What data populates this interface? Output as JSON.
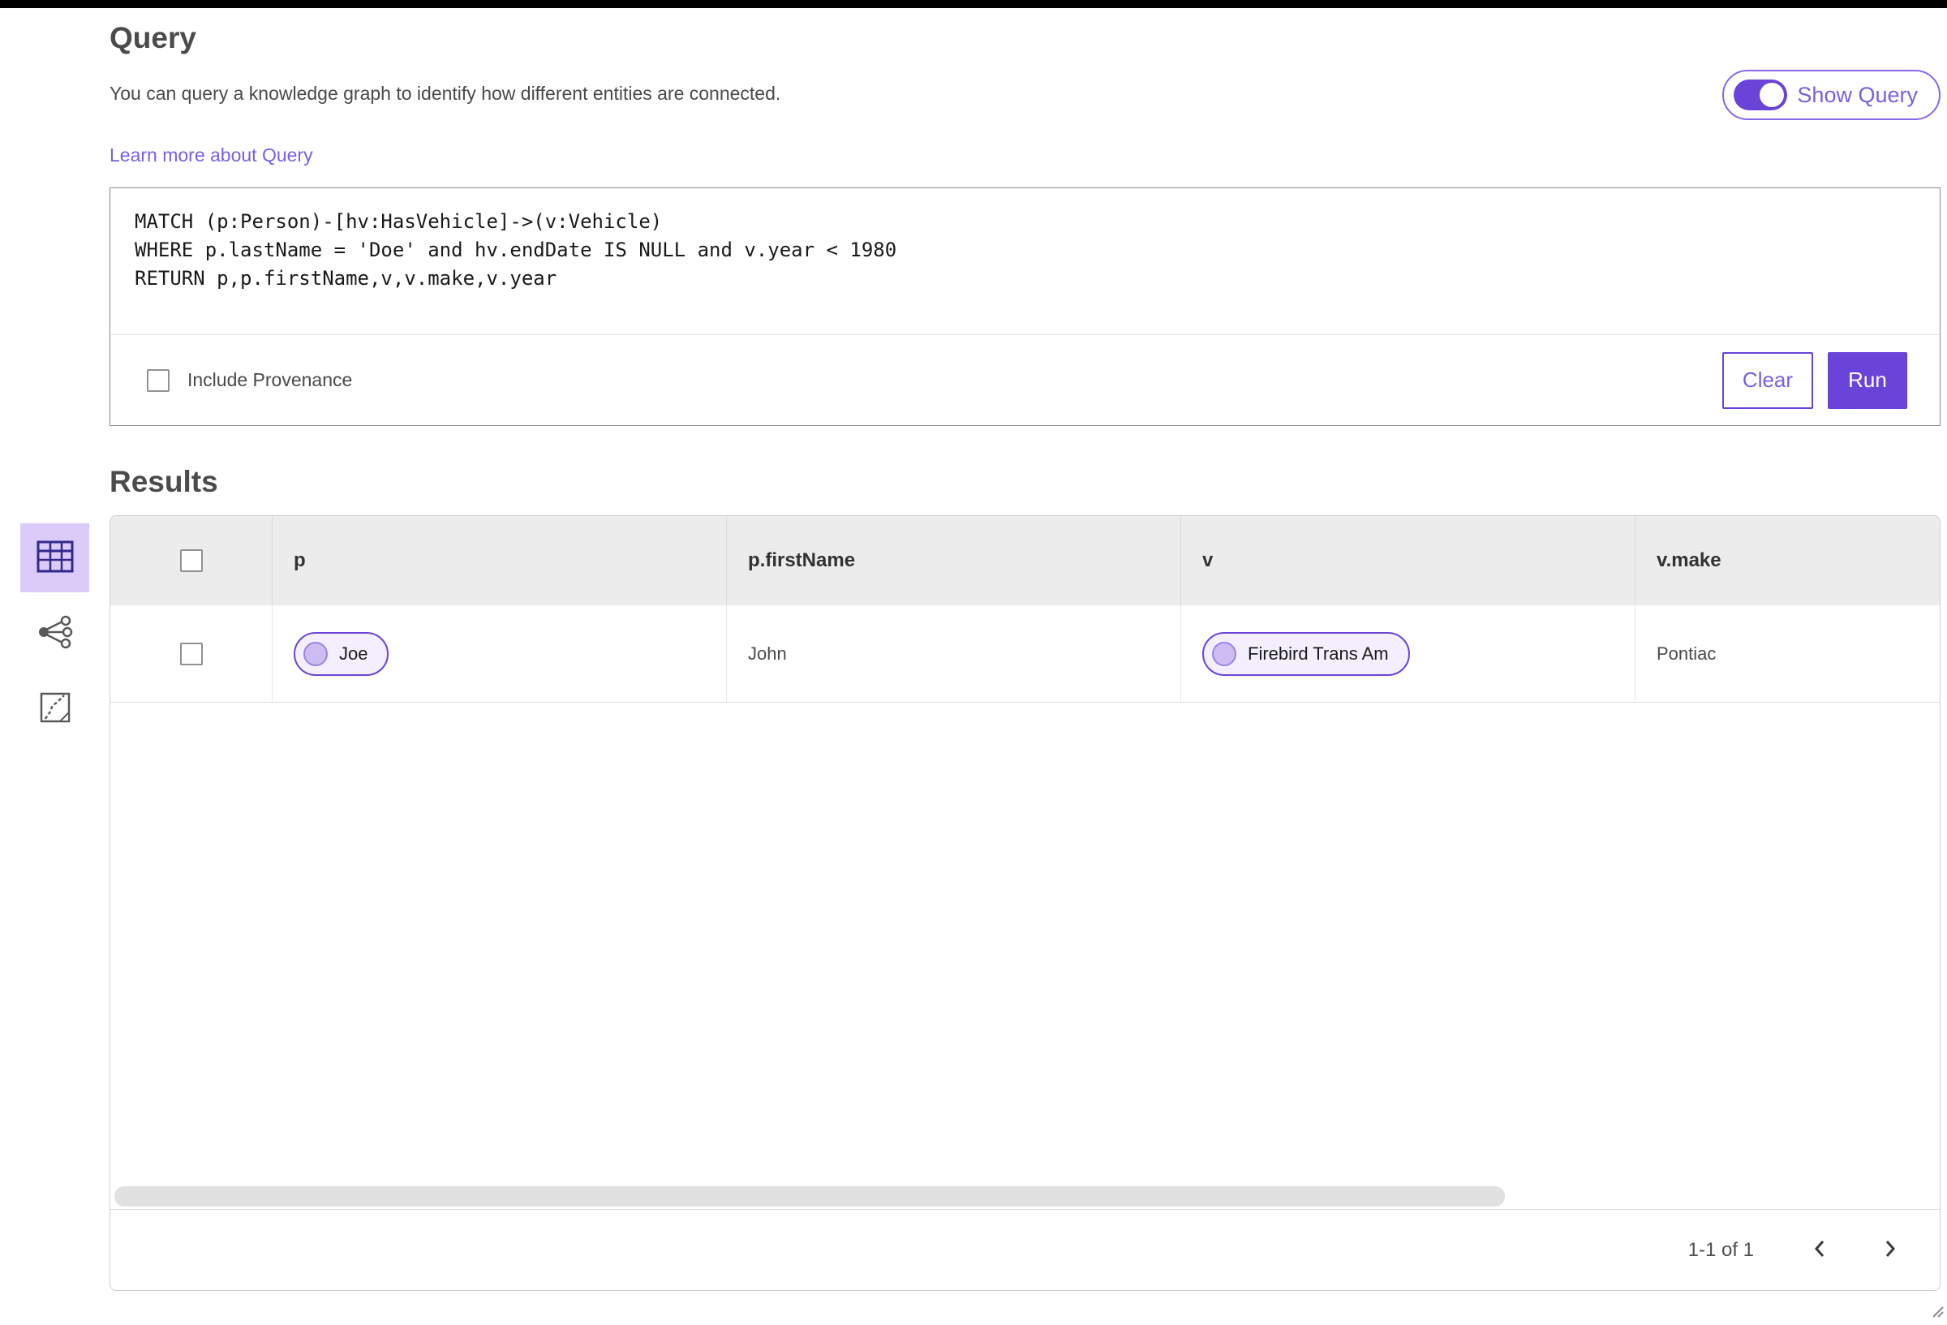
{
  "header": {
    "title": "Query",
    "description": "You can query a knowledge graph to identify how different entities are connected.",
    "learn_more_label": "Learn more about Query",
    "show_query_label": "Show Query",
    "show_query_state": "on"
  },
  "query_panel": {
    "code": "MATCH (p:Person)-[hv:HasVehicle]->(v:Vehicle)\nWHERE p.lastName = 'Doe' and hv.endDate IS NULL and v.year < 1980\nRETURN p,p.firstName,v,v.make,v.year",
    "include_provenance_label": "Include Provenance",
    "include_provenance_checked": false,
    "clear_label": "Clear",
    "run_label": "Run"
  },
  "results": {
    "heading": "Results",
    "views": [
      {
        "name": "table-view",
        "icon": "table-icon",
        "selected": true
      },
      {
        "name": "link-chart-view",
        "icon": "link-chart-icon",
        "selected": false
      },
      {
        "name": "map-view",
        "icon": "map-icon",
        "selected": false
      }
    ],
    "table": {
      "columns": [
        "p",
        "p.firstName",
        "v",
        "v.make"
      ],
      "rows": [
        {
          "p_label": "Joe",
          "p_firstName": "John",
          "v_label": "Firebird Trans Am",
          "v_make": "Pontiac",
          "checked": false
        }
      ],
      "pagination_label": "1-1 of 1"
    }
  },
  "colors": {
    "accent": "#6a43d9",
    "accent_light_bg": "#dbcbf8",
    "chip_bg": "#f4effe",
    "link": "#7a5fe2",
    "table_header_bg": "#ececec"
  }
}
